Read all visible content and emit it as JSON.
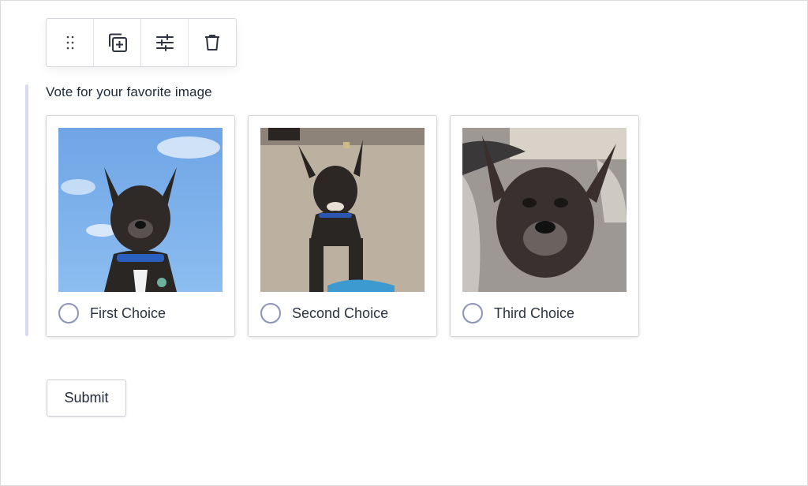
{
  "toolbar": {
    "buttons": [
      {
        "icon": "drag-handle-icon"
      },
      {
        "icon": "duplicate-icon"
      },
      {
        "icon": "settings-sliders-icon"
      },
      {
        "icon": "trash-icon"
      }
    ]
  },
  "field": {
    "label": "Vote for your favorite image"
  },
  "choices": [
    {
      "label": "First Choice",
      "image": "dog-sky-photo",
      "selected": false
    },
    {
      "label": "Second Choice",
      "image": "dog-carpet-photo",
      "selected": false
    },
    {
      "label": "Third Choice",
      "image": "dog-blanket-photo",
      "selected": false
    }
  ],
  "submit": {
    "label": "Submit"
  },
  "colors": {
    "radio_border": "#8d93b8",
    "accent_bar": "#d7d9ef",
    "text": "#1f2937"
  }
}
